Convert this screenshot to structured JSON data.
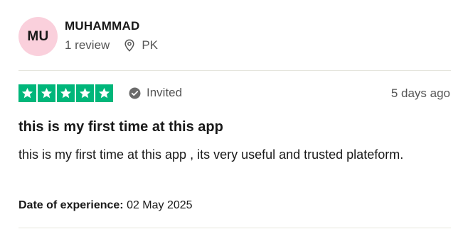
{
  "reviewer": {
    "initials": "MU",
    "name": "MUHAMMAD",
    "review_count": "1 review",
    "country": "PK",
    "avatar_color": "#fad0dc"
  },
  "review": {
    "rating": 5,
    "rating_color": "#00b67a",
    "status_label": "Invited",
    "posted": "5 days ago",
    "title": "this is my first time at this app",
    "body": "this is my first time at this app , its very useful and trusted plateform.",
    "experience_label": "Date of experience:",
    "experience_date": "02 May 2025"
  },
  "icons": {
    "location": "location-pin-icon",
    "status": "check-circle-icon",
    "star": "star-icon"
  }
}
